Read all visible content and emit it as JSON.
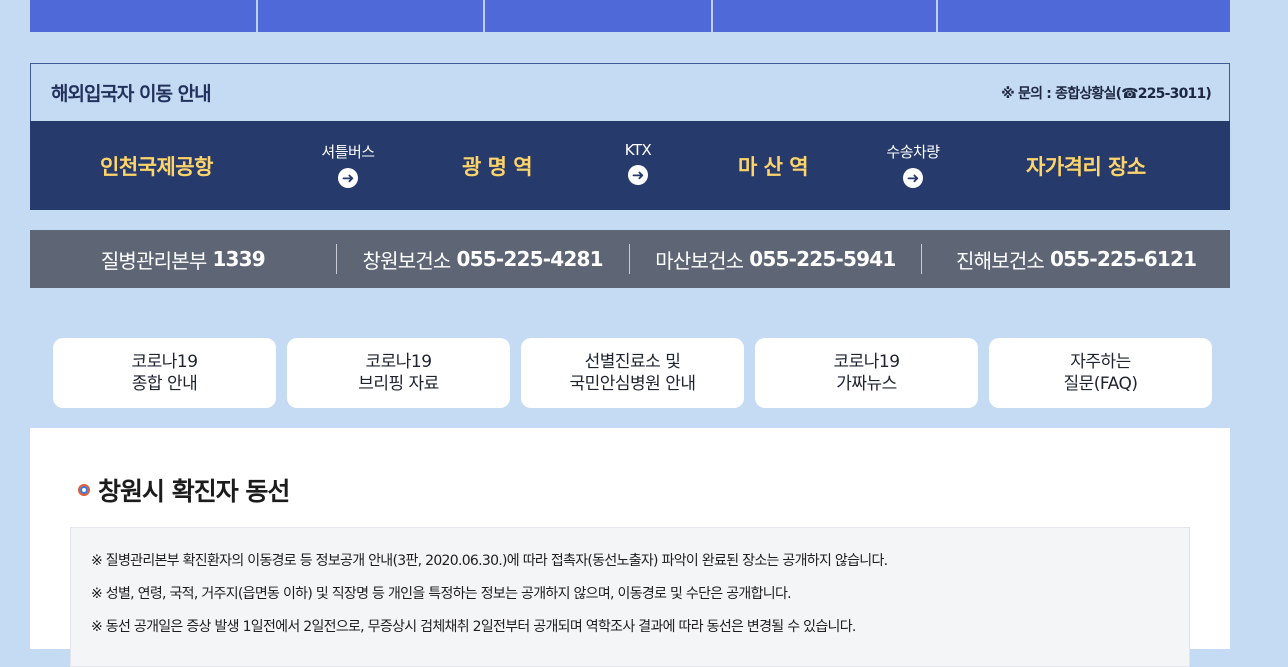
{
  "colors": {
    "page_bg": "#c5daf3",
    "tab_blue": "#4f6ad8",
    "route_bar": "#273a6c",
    "place_text": "#ffd56a",
    "phone_bar": "#5e6676"
  },
  "entrant": {
    "title": "해외입국자 이동 안내",
    "contact": "※ 문의 : 종합상황실(☎225-3011)",
    "places": [
      "인천국제공항",
      "광 명 역",
      "마 산 역",
      "자가격리 장소"
    ],
    "connectors": [
      {
        "label": "셔틀버스",
        "icon": "arrow-right-circle-icon"
      },
      {
        "label": "KTX",
        "icon": "arrow-right-circle-icon"
      },
      {
        "label": "수송차량",
        "icon": "arrow-right-circle-icon"
      }
    ]
  },
  "phones": [
    {
      "name": "질병관리본부",
      "number": "1339"
    },
    {
      "name": "창원보건소",
      "number": "055-225-4281"
    },
    {
      "name": "마산보건소",
      "number": "055-225-5941"
    },
    {
      "name": "진해보건소",
      "number": "055-225-6121"
    }
  ],
  "quick_menu": [
    {
      "line1": "코로나19",
      "line2": "종합 안내"
    },
    {
      "line1": "코로나19",
      "line2": "브리핑 자료"
    },
    {
      "line1": "선별진료소 및",
      "line2": "국민안심병원 안내"
    },
    {
      "line1": "코로나19",
      "line2": "가짜뉴스"
    },
    {
      "line1": "자주하는",
      "line2": "질문(FAQ)"
    }
  ],
  "section": {
    "title": "창원시 확진자 동선",
    "notices": [
      "※ 질병관리본부 확진환자의 이동경로 등 정보공개 안내(3판, 2020.06.30.)에 따라 접촉자(동선노출자) 파악이 완료된 장소는 공개하지 않습니다.",
      "※ 성별, 연령, 국적, 거주지(읍면동 이하) 및 직장명 등 개인을 특정하는 정보는 공개하지 않으며, 이동경로 및 수단은 공개합니다.",
      "※ 동선 공개일은 증상 발생 1일전에서 2일전으로, 무증상시 검체채취 2일전부터 공개되며 역학조사 결과에 따라 동선은 변경될 수 있습니다."
    ]
  }
}
